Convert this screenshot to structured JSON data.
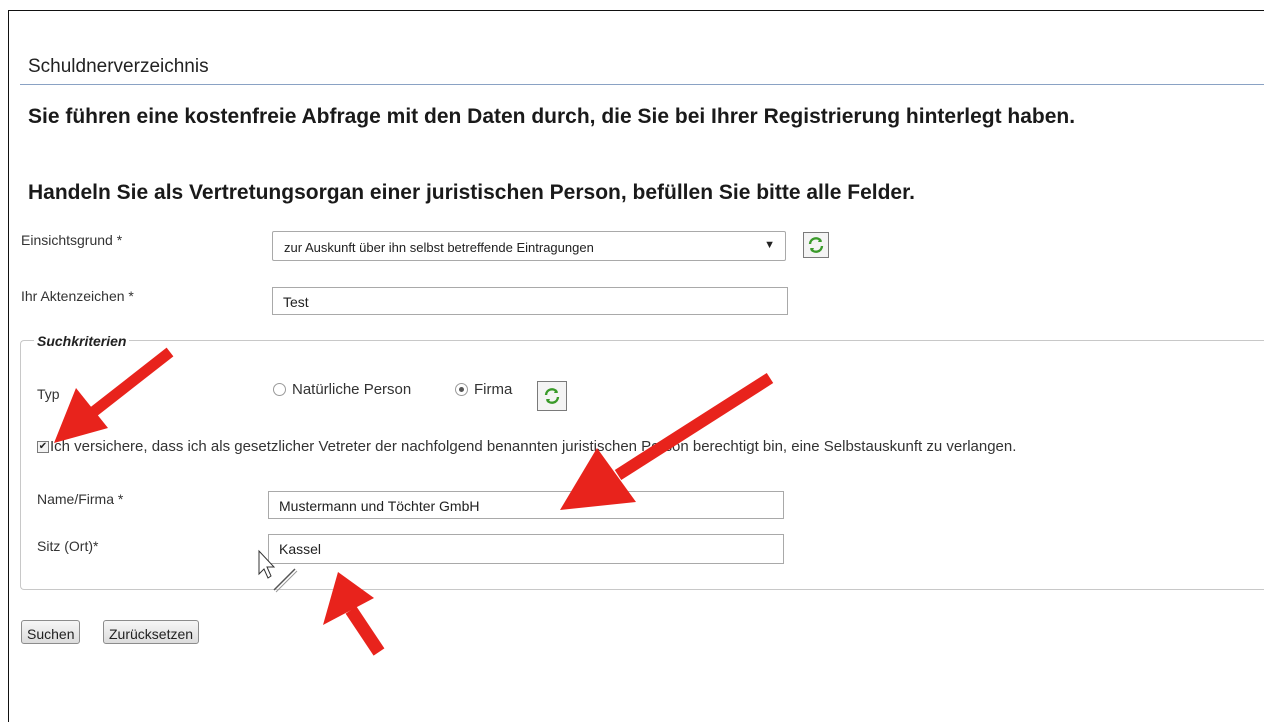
{
  "page": {
    "title": "Schuldnerverzeichnis",
    "heading1": "Sie führen eine kostenfreie Abfrage mit den Daten durch, die Sie bei Ihrer Registrierung hinterlegt haben.",
    "heading2": "Handeln Sie als Vertretungsorgan einer juristischen Person, befüllen Sie bitte alle Felder."
  },
  "form": {
    "einsichtsgrund_label": "Einsichtsgrund *",
    "einsichtsgrund_value": "zur Auskunft über ihn selbst betreffende Eintragungen",
    "aktenzeichen_label": "Ihr Aktenzeichen *",
    "aktenzeichen_value": "Test"
  },
  "suchkriterien": {
    "legend": "Suchkriterien",
    "typ_label": "Typ",
    "typ_options": [
      "Natürliche Person",
      "Firma"
    ],
    "typ_selected": "Firma",
    "consent_checked": true,
    "consent_text": "Ich versichere, dass ich als gesetzlicher Vetreter der nachfolgend benannten juristischen Person berechtigt bin, eine Selbstauskunft zu verlangen.",
    "name_label": "Name/Firma *",
    "name_value": "Mustermann und Töchter GmbH",
    "sitz_label": "Sitz (Ort)*",
    "sitz_value": "Kassel"
  },
  "buttons": {
    "search": "Suchen",
    "reset": "Zurücksetzen"
  },
  "annotations": {
    "arrow_color": "#e8231c"
  }
}
